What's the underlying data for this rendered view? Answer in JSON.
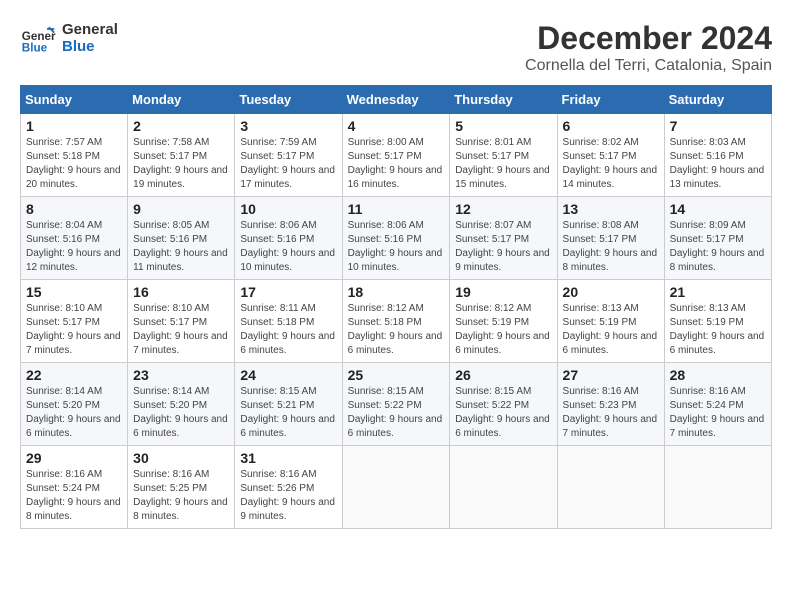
{
  "header": {
    "logo_line1": "General",
    "logo_line2": "Blue",
    "main_title": "December 2024",
    "subtitle": "Cornella del Terri, Catalonia, Spain"
  },
  "weekdays": [
    "Sunday",
    "Monday",
    "Tuesday",
    "Wednesday",
    "Thursday",
    "Friday",
    "Saturday"
  ],
  "weeks": [
    [
      {
        "day": "1",
        "sunrise": "7:57 AM",
        "sunset": "5:18 PM",
        "daylight": "9 hours and 20 minutes."
      },
      {
        "day": "2",
        "sunrise": "7:58 AM",
        "sunset": "5:17 PM",
        "daylight": "9 hours and 19 minutes."
      },
      {
        "day": "3",
        "sunrise": "7:59 AM",
        "sunset": "5:17 PM",
        "daylight": "9 hours and 17 minutes."
      },
      {
        "day": "4",
        "sunrise": "8:00 AM",
        "sunset": "5:17 PM",
        "daylight": "9 hours and 16 minutes."
      },
      {
        "day": "5",
        "sunrise": "8:01 AM",
        "sunset": "5:17 PM",
        "daylight": "9 hours and 15 minutes."
      },
      {
        "day": "6",
        "sunrise": "8:02 AM",
        "sunset": "5:17 PM",
        "daylight": "9 hours and 14 minutes."
      },
      {
        "day": "7",
        "sunrise": "8:03 AM",
        "sunset": "5:16 PM",
        "daylight": "9 hours and 13 minutes."
      }
    ],
    [
      {
        "day": "8",
        "sunrise": "8:04 AM",
        "sunset": "5:16 PM",
        "daylight": "9 hours and 12 minutes."
      },
      {
        "day": "9",
        "sunrise": "8:05 AM",
        "sunset": "5:16 PM",
        "daylight": "9 hours and 11 minutes."
      },
      {
        "day": "10",
        "sunrise": "8:06 AM",
        "sunset": "5:16 PM",
        "daylight": "9 hours and 10 minutes."
      },
      {
        "day": "11",
        "sunrise": "8:06 AM",
        "sunset": "5:16 PM",
        "daylight": "9 hours and 10 minutes."
      },
      {
        "day": "12",
        "sunrise": "8:07 AM",
        "sunset": "5:17 PM",
        "daylight": "9 hours and 9 minutes."
      },
      {
        "day": "13",
        "sunrise": "8:08 AM",
        "sunset": "5:17 PM",
        "daylight": "9 hours and 8 minutes."
      },
      {
        "day": "14",
        "sunrise": "8:09 AM",
        "sunset": "5:17 PM",
        "daylight": "9 hours and 8 minutes."
      }
    ],
    [
      {
        "day": "15",
        "sunrise": "8:10 AM",
        "sunset": "5:17 PM",
        "daylight": "9 hours and 7 minutes."
      },
      {
        "day": "16",
        "sunrise": "8:10 AM",
        "sunset": "5:17 PM",
        "daylight": "9 hours and 7 minutes."
      },
      {
        "day": "17",
        "sunrise": "8:11 AM",
        "sunset": "5:18 PM",
        "daylight": "9 hours and 6 minutes."
      },
      {
        "day": "18",
        "sunrise": "8:12 AM",
        "sunset": "5:18 PM",
        "daylight": "9 hours and 6 minutes."
      },
      {
        "day": "19",
        "sunrise": "8:12 AM",
        "sunset": "5:19 PM",
        "daylight": "9 hours and 6 minutes."
      },
      {
        "day": "20",
        "sunrise": "8:13 AM",
        "sunset": "5:19 PM",
        "daylight": "9 hours and 6 minutes."
      },
      {
        "day": "21",
        "sunrise": "8:13 AM",
        "sunset": "5:19 PM",
        "daylight": "9 hours and 6 minutes."
      }
    ],
    [
      {
        "day": "22",
        "sunrise": "8:14 AM",
        "sunset": "5:20 PM",
        "daylight": "9 hours and 6 minutes."
      },
      {
        "day": "23",
        "sunrise": "8:14 AM",
        "sunset": "5:20 PM",
        "daylight": "9 hours and 6 minutes."
      },
      {
        "day": "24",
        "sunrise": "8:15 AM",
        "sunset": "5:21 PM",
        "daylight": "9 hours and 6 minutes."
      },
      {
        "day": "25",
        "sunrise": "8:15 AM",
        "sunset": "5:22 PM",
        "daylight": "9 hours and 6 minutes."
      },
      {
        "day": "26",
        "sunrise": "8:15 AM",
        "sunset": "5:22 PM",
        "daylight": "9 hours and 6 minutes."
      },
      {
        "day": "27",
        "sunrise": "8:16 AM",
        "sunset": "5:23 PM",
        "daylight": "9 hours and 7 minutes."
      },
      {
        "day": "28",
        "sunrise": "8:16 AM",
        "sunset": "5:24 PM",
        "daylight": "9 hours and 7 minutes."
      }
    ],
    [
      {
        "day": "29",
        "sunrise": "8:16 AM",
        "sunset": "5:24 PM",
        "daylight": "9 hours and 8 minutes."
      },
      {
        "day": "30",
        "sunrise": "8:16 AM",
        "sunset": "5:25 PM",
        "daylight": "9 hours and 8 minutes."
      },
      {
        "day": "31",
        "sunrise": "8:16 AM",
        "sunset": "5:26 PM",
        "daylight": "9 hours and 9 minutes."
      },
      null,
      null,
      null,
      null
    ]
  ]
}
